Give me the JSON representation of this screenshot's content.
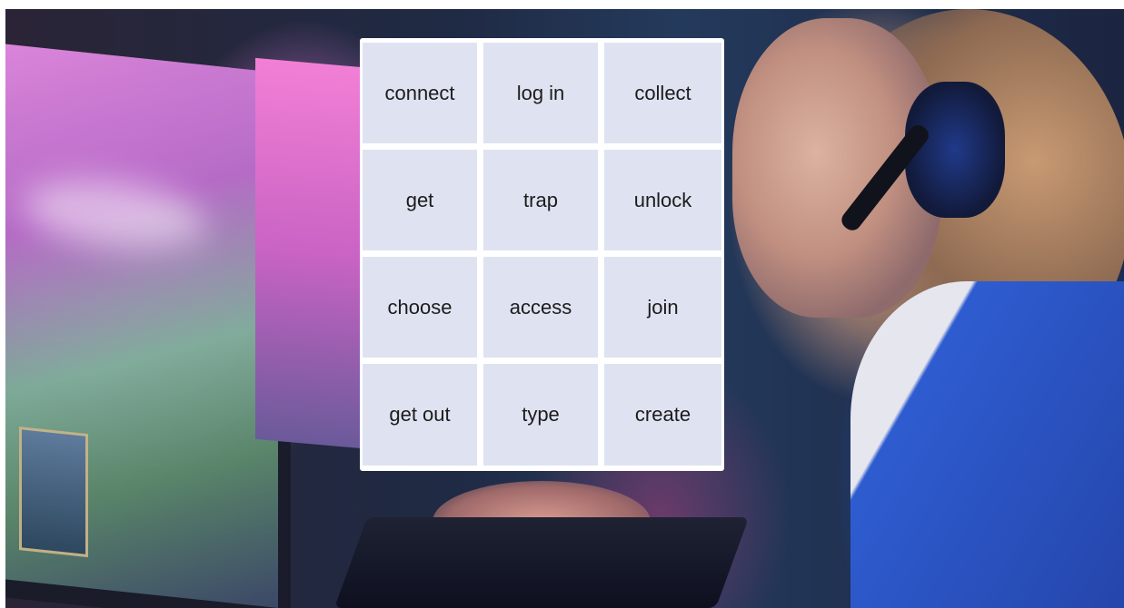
{
  "background": {
    "description_icon": "gamer-photo",
    "accent_colors": [
      "#d26ad8",
      "#2f58c8",
      "#1f2a44"
    ]
  },
  "word_grid": {
    "tile_color": "#dfe3f1",
    "words": [
      "connect",
      "log in",
      "collect",
      "get",
      "trap",
      "unlock",
      "choose",
      "access",
      "join",
      "get out",
      "type",
      "create"
    ]
  }
}
